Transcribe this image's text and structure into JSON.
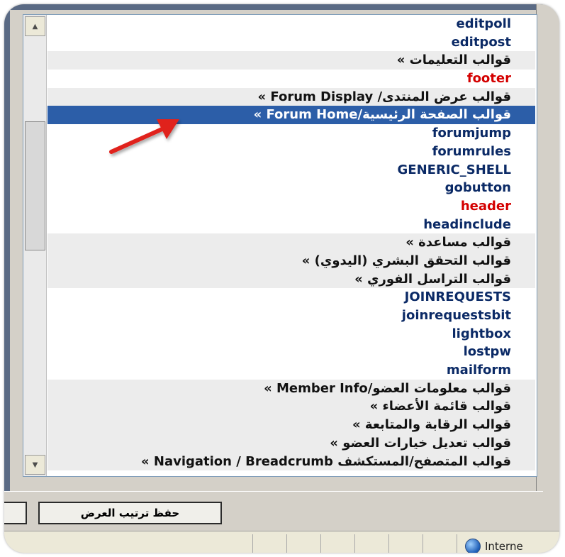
{
  "listbox": {
    "items": [
      {
        "text": "editpoll",
        "kind": "normal"
      },
      {
        "text": "editpost",
        "kind": "normal"
      },
      {
        "text": "قوالب التعليمات »",
        "kind": "group"
      },
      {
        "text": "footer",
        "kind": "red"
      },
      {
        "text": "قوالب عرض المنتدى/ Forum Display »",
        "kind": "group"
      },
      {
        "text": "قوالب الصفحة الرئيسية/Forum Home »",
        "kind": "selected"
      },
      {
        "text": "forumjump",
        "kind": "normal"
      },
      {
        "text": "forumrules",
        "kind": "normal"
      },
      {
        "text": "GENERIC_SHELL",
        "kind": "normal"
      },
      {
        "text": "gobutton",
        "kind": "normal"
      },
      {
        "text": "header",
        "kind": "red"
      },
      {
        "text": "headinclude",
        "kind": "normal"
      },
      {
        "text": "قوالب مساعدة »",
        "kind": "group"
      },
      {
        "text": "قوالب التحقق البشري (اليدوي) »",
        "kind": "group"
      },
      {
        "text": "قوالب التراسل الفوري »",
        "kind": "group"
      },
      {
        "text": "JOINREQUESTS",
        "kind": "normal"
      },
      {
        "text": "joinrequestsbit",
        "kind": "normal"
      },
      {
        "text": "lightbox",
        "kind": "normal"
      },
      {
        "text": "lostpw",
        "kind": "normal"
      },
      {
        "text": "mailform",
        "kind": "normal"
      },
      {
        "text": "قوالب معلومات العضو/Member Info »",
        "kind": "group"
      },
      {
        "text": "قوالب قائمة الأعضاء »",
        "kind": "group"
      },
      {
        "text": "قوالب الرقابة والمتابعة »",
        "kind": "group"
      },
      {
        "text": "قوالب تعديل خيارات العضو »",
        "kind": "group"
      },
      {
        "text": "قوالب المتصفح/المستكشف Navigation / Breadcrumb »",
        "kind": "group"
      }
    ],
    "scroll_up_icon": "triangle-up",
    "scroll_down_icon": "triangle-down"
  },
  "toolbar": {
    "save_label": "حفظ ترتيب العرض"
  },
  "status": {
    "zone_label": "Interne"
  },
  "colors": {
    "selected_bg": "#2c5ea8",
    "red_text": "#d40000",
    "group_bg": "#ececec",
    "arrow": "#e0201c"
  }
}
